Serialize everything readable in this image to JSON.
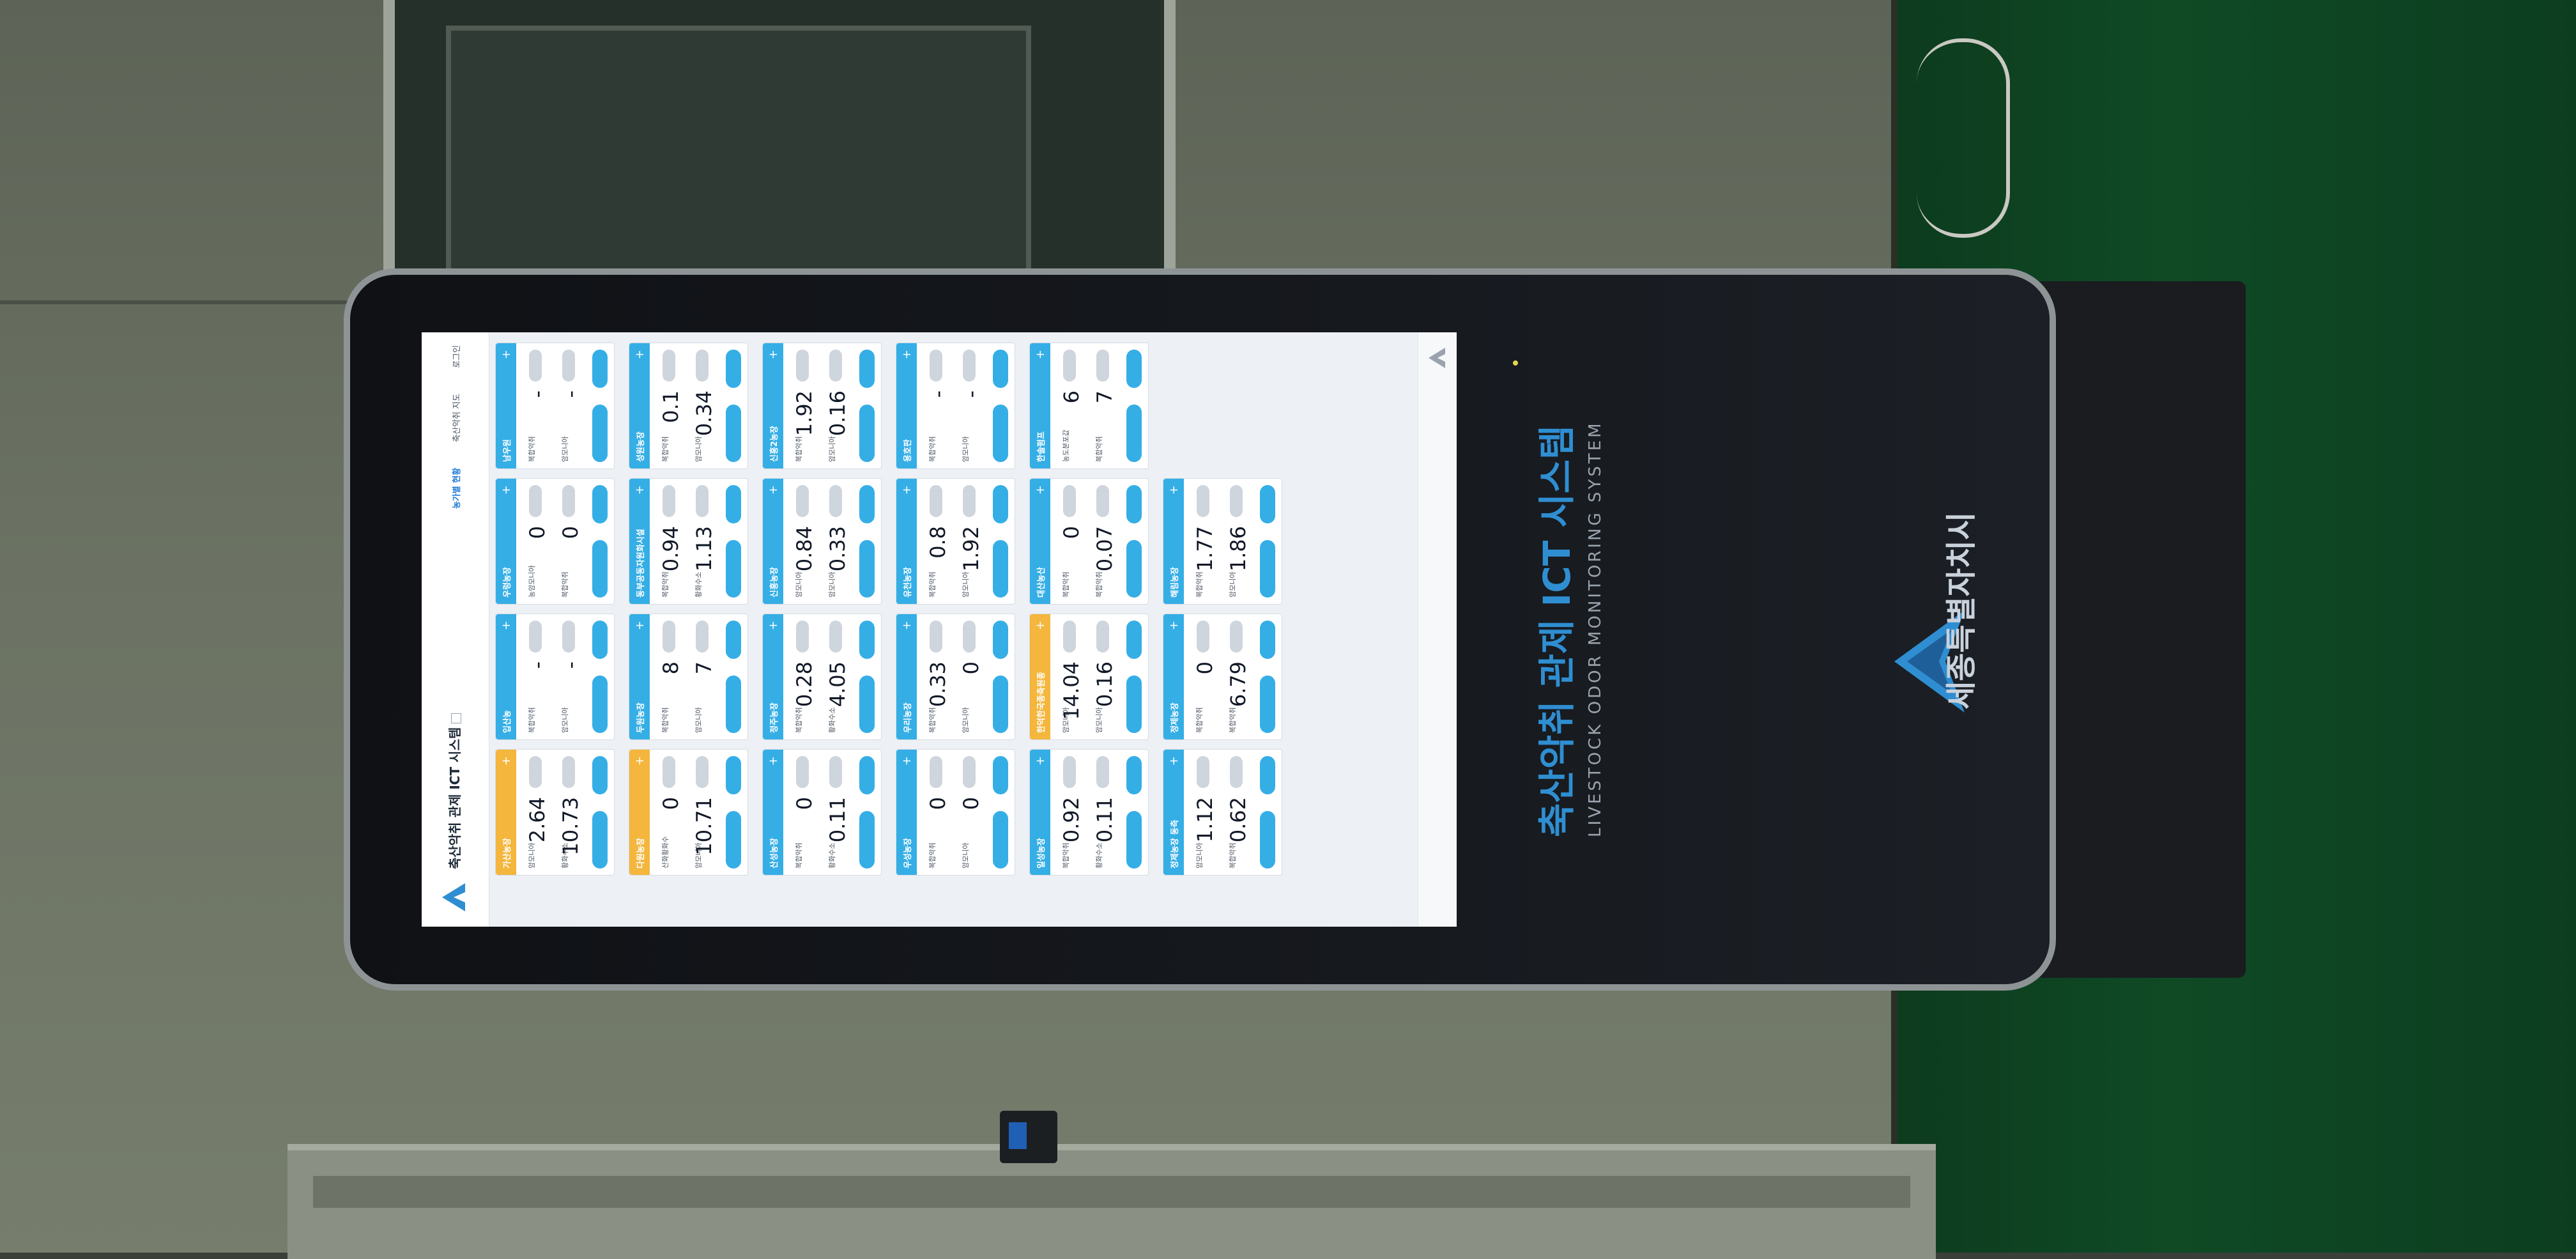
{
  "kiosk": {
    "title_ko": "축산악취 관제 ICT 시스템",
    "title_en": "LIVESTOCK ODOR MONITORING SYSTEM",
    "city": "세종특별자치시"
  },
  "app": {
    "title": "축산악취 관제 ICT 시스템",
    "nav": [
      "농가별 현황",
      "축산악취 지도",
      "로그인"
    ]
  },
  "cards": [
    {
      "name": "가산농장",
      "alert": true,
      "r1_label": "암모니아",
      "r1_value": "2.64",
      "r2_label": "황화수소",
      "r2_value": "10.73"
    },
    {
      "name": "입산농",
      "alert": false,
      "r1_label": "복합악취",
      "r1_value": "-",
      "r2_label": "암모니아",
      "r2_value": "-"
    },
    {
      "name": "우렁농장",
      "alert": false,
      "r1_label": "농암모니아",
      "r1_value": "0",
      "r2_label": "복합악취",
      "r2_value": "0"
    },
    {
      "name": "남우원",
      "alert": false,
      "r1_label": "복합악취",
      "r1_value": "-",
      "r2_label": "암모니아",
      "r2_value": "-"
    },
    {
      "name": "다원농장",
      "alert": true,
      "r1_label": "산화황화수",
      "r1_value": "0",
      "r2_label": "암모니아",
      "r2_value": "10.71"
    },
    {
      "name": "두원농장",
      "alert": false,
      "r1_label": "복합악취",
      "r1_value": "8",
      "r2_label": "암모니아",
      "r2_value": "7"
    },
    {
      "name": "동부공동자원화시설",
      "alert": false,
      "r1_label": "복합악취",
      "r1_value": "0.94",
      "r2_label": "황화수소",
      "r2_value": "1.13"
    },
    {
      "name": "성원농장",
      "alert": false,
      "r1_label": "복합악취",
      "r1_value": "0.1",
      "r2_label": "암모니아",
      "r2_value": "0.34"
    },
    {
      "name": "산성농장",
      "alert": false,
      "r1_label": "복합악취",
      "r1_value": "0",
      "r2_label": "황화수소",
      "r2_value": "0.11"
    },
    {
      "name": "정주농장",
      "alert": false,
      "r1_label": "복합악취",
      "r1_value": "0.28",
      "r2_label": "황화수소",
      "r2_value": "4.05"
    },
    {
      "name": "신흥농장",
      "alert": false,
      "r1_label": "암모니아",
      "r1_value": "0.84",
      "r2_label": "암모니아",
      "r2_value": "0.33"
    },
    {
      "name": "신흥2농장",
      "alert": false,
      "r1_label": "복합악취",
      "r1_value": "1.92",
      "r2_label": "암모니아",
      "r2_value": "0.16"
    },
    {
      "name": "우성농장",
      "alert": false,
      "r1_label": "복합악취",
      "r1_value": "0",
      "r2_label": "암모니아",
      "r2_value": "0"
    },
    {
      "name": "우리농장",
      "alert": false,
      "r1_label": "복합악취",
      "r1_value": "0.33",
      "r2_label": "암모니아",
      "r2_value": "0"
    },
    {
      "name": "유천농장",
      "alert": false,
      "r1_label": "복합악취",
      "r1_value": "0.8",
      "r2_label": "암모니아",
      "r2_value": "1.92"
    },
    {
      "name": "용호판",
      "alert": false,
      "r1_label": "복합악취",
      "r1_value": "-",
      "r2_label": "암모니아",
      "r2_value": "-"
    },
    {
      "name": "일성농장",
      "alert": false,
      "r1_label": "복합악취",
      "r1_value": "0.92",
      "r2_label": "황화수소",
      "r2_value": "0.11"
    },
    {
      "name": "한덕한국종축원종",
      "alert": true,
      "r1_label": "암모니아",
      "r1_value": "14.04",
      "r2_label": "암모니아",
      "r2_value": "0.16"
    },
    {
      "name": "대산농산",
      "alert": false,
      "r1_label": "복합악취",
      "r1_value": "0",
      "r2_label": "복합악취",
      "r2_value": "0.07"
    },
    {
      "name": "한솔펌프",
      "alert": false,
      "r1_label": "농도분포값",
      "r1_value": "6",
      "r2_label": "복합악취",
      "r2_value": "7"
    },
    {
      "name": "정제농장 동측",
      "alert": false,
      "r1_label": "암모니아",
      "r1_value": "1.12",
      "r2_label": "복합악취",
      "r2_value": "0.62"
    },
    {
      "name": "정제농장",
      "alert": false,
      "r1_label": "복합악취",
      "r1_value": "0",
      "r2_label": "복합악취",
      "r2_value": "6.79"
    },
    {
      "name": "해림농장",
      "alert": false,
      "r1_label": "복합악취",
      "r1_value": "1.77",
      "r2_label": "암모니아",
      "r2_value": "1.86"
    }
  ]
}
